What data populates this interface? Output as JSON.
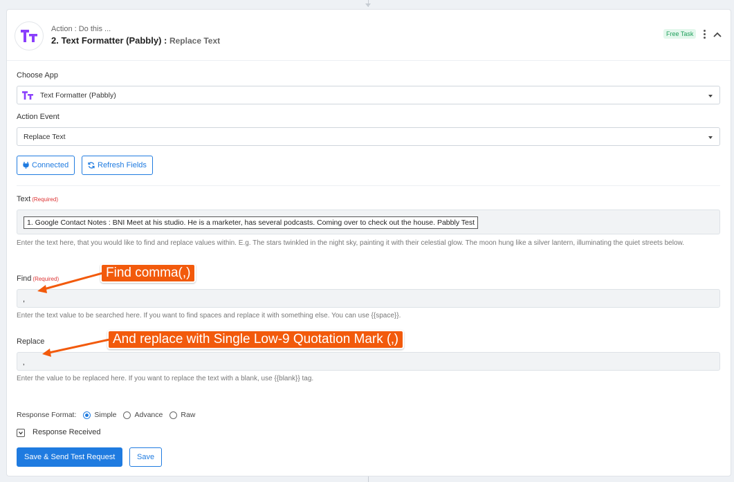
{
  "header": {
    "subtitle": "Action : Do this ...",
    "title": "2. Text Formatter (Pabbly) :",
    "event": "Replace Text",
    "badge": "Free Task"
  },
  "choose_app": {
    "label": "Choose App",
    "value": "Text Formatter (Pabbly)"
  },
  "action_event": {
    "label": "Action Event",
    "value": "Replace Text"
  },
  "buttons": {
    "connected": "Connected",
    "refresh": "Refresh Fields",
    "send_test": "Save & Send Test Request",
    "save": "Save"
  },
  "text_field": {
    "label": "Text",
    "required": "(Required)",
    "value": "1. Google Contact Notes : BNI Meet at his studio. He is a marketer, has several podcasts. Coming over to check out the house. Pabbly Test",
    "help": "Enter the text here, that you would like to find and replace values within. E.g. The stars twinkled in the night sky, painting it with their celestial glow. The moon hung like a silver lantern, illuminating the quiet streets below."
  },
  "find_field": {
    "label": "Find",
    "required": "(Required)",
    "value": ",",
    "help": "Enter the text value to be searched here. If you want to find spaces and replace it with something else. You can use {{space}}."
  },
  "replace_field": {
    "label": "Replace",
    "value": "‚",
    "help": "Enter the value to be replaced here. If you want to replace the text with a blank, use {{blank}} tag."
  },
  "callouts": {
    "find": "Find comma(,)",
    "replace": "And replace with  Single Low-9 Quotation Mark (‚)"
  },
  "response": {
    "label": "Response Format:",
    "options": [
      "Simple",
      "Advance",
      "Raw"
    ],
    "selected": "Simple",
    "received_label": "Response Received"
  },
  "colors": {
    "primary": "#1f7be0",
    "callout": "#f25a0c",
    "logo": "#8a3ffc",
    "badge_bg": "#e3f7ec",
    "badge_text": "#1e9e5a"
  }
}
